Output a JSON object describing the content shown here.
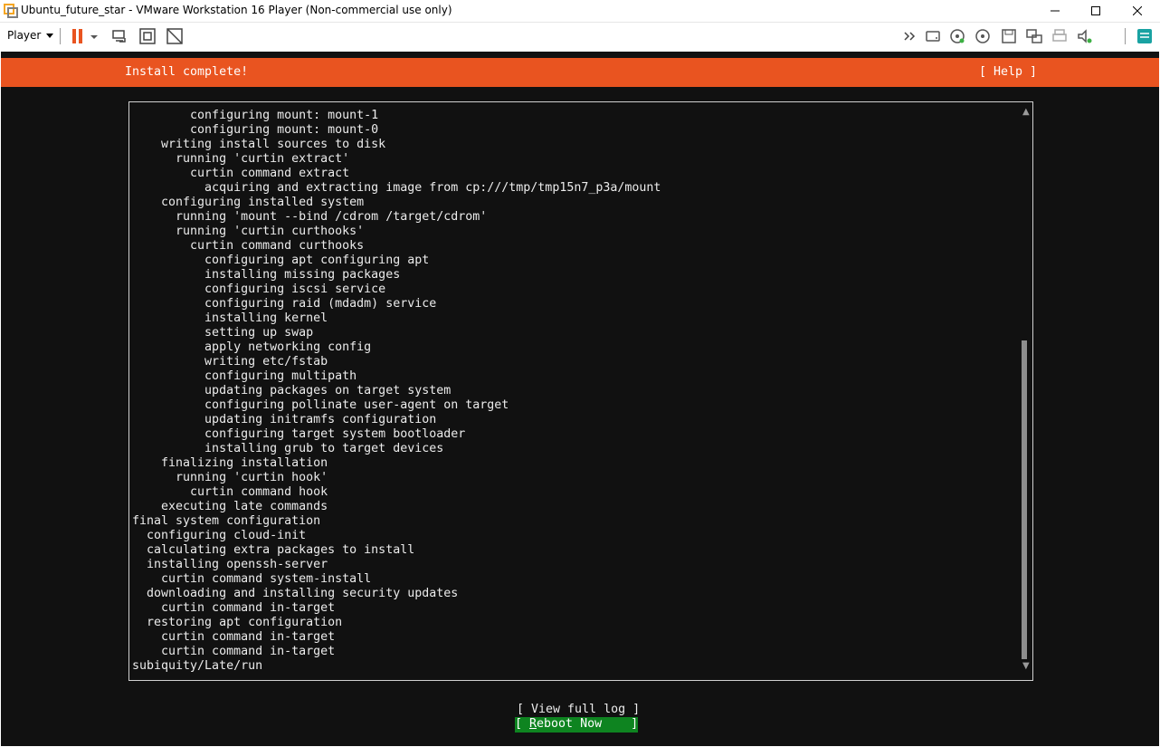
{
  "window": {
    "title": "Ubuntu_future_star - VMware Workstation 16 Player (Non-commercial use only)",
    "controls": {
      "minimize": "—",
      "maximize": "☐",
      "close": "✕"
    }
  },
  "toolbar": {
    "player_label": "Player",
    "left_icons": [
      "pause-icon",
      "send-ctrl-alt-del-icon",
      "fullscreen-icon",
      "unity-icon"
    ],
    "right_icons": [
      "more-icon",
      "hard-disk-icon",
      "cd-dvd-icon",
      "cd-dvd-2-icon",
      "floppy-icon",
      "network-adapter-icon",
      "printer-icon",
      "sound-card-icon",
      "message-log-icon"
    ],
    "accent_color": "#e95420"
  },
  "installer": {
    "header_title": "Install complete!",
    "help_label": "[ Help ]",
    "header_color": "#e95420",
    "log_lines": [
      "        configuring mount: mount-1",
      "        configuring mount: mount-0",
      "    writing install sources to disk",
      "      running 'curtin extract'",
      "        curtin command extract",
      "          acquiring and extracting image from cp:///tmp/tmp15n7_p3a/mount",
      "    configuring installed system",
      "      running 'mount --bind /cdrom /target/cdrom'",
      "      running 'curtin curthooks'",
      "        curtin command curthooks",
      "          configuring apt configuring apt",
      "          installing missing packages",
      "          configuring iscsi service",
      "          configuring raid (mdadm) service",
      "          installing kernel",
      "          setting up swap",
      "          apply networking config",
      "          writing etc/fstab",
      "          configuring multipath",
      "          updating packages on target system",
      "          configuring pollinate user-agent on target",
      "          updating initramfs configuration",
      "          configuring target system bootloader",
      "          installing grub to target devices",
      "    finalizing installation",
      "      running 'curtin hook'",
      "        curtin command hook",
      "    executing late commands",
      "final system configuration",
      "  configuring cloud-init",
      "  calculating extra packages to install",
      "  installing openssh-server",
      "    curtin command system-install",
      "  downloading and installing security updates",
      "    curtin command in-target",
      "  restoring apt configuration",
      "    curtin command in-target",
      "    curtin command in-target",
      "subiquity/Late/run"
    ],
    "scroll_up_glyph": "▲",
    "scroll_down_glyph": "▼",
    "view_log_label": "[ View full log ]",
    "reboot": {
      "prefix": "[ ",
      "hotkey": "R",
      "rest": "eboot Now",
      "suffix": "    ]"
    },
    "reboot_color": "#0e8420"
  }
}
